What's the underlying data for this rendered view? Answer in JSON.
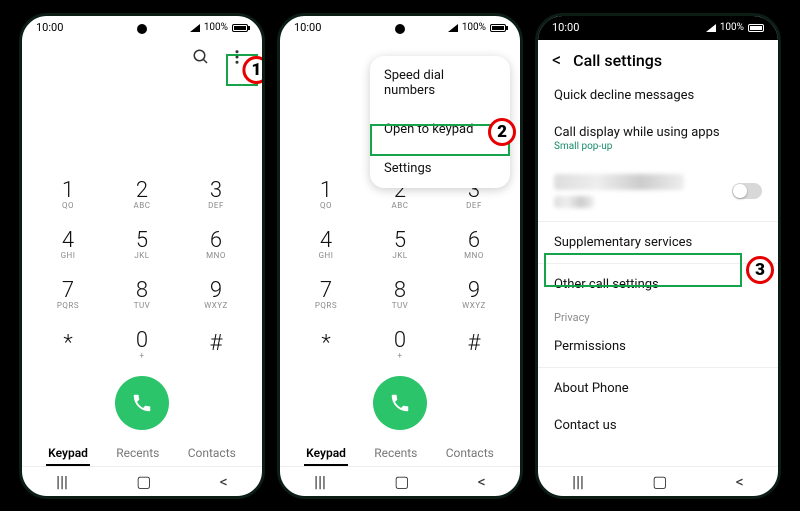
{
  "status": {
    "time": "10:00",
    "battery": "100%"
  },
  "phone1": {
    "tabs": {
      "keypad": "Keypad",
      "recents": "Recents",
      "contacts": "Contacts"
    },
    "marker": "1"
  },
  "keypad": [
    {
      "d": "1",
      "s": "QO"
    },
    {
      "d": "2",
      "s": "ABC"
    },
    {
      "d": "3",
      "s": "DEF"
    },
    {
      "d": "4",
      "s": "GHI"
    },
    {
      "d": "5",
      "s": "JKL"
    },
    {
      "d": "6",
      "s": "MNO"
    },
    {
      "d": "7",
      "s": "PQRS"
    },
    {
      "d": "8",
      "s": "TUV"
    },
    {
      "d": "9",
      "s": "WXYZ"
    },
    {
      "d": "*",
      "s": ""
    },
    {
      "d": "0",
      "s": "+"
    },
    {
      "d": "#",
      "s": ""
    }
  ],
  "phone2": {
    "menu": {
      "speed": "Speed dial numbers",
      "open": "Open to keypad",
      "settings": "Settings"
    },
    "marker": "2"
  },
  "phone3": {
    "title": "Call settings",
    "rows": {
      "quick": "Quick decline messages",
      "display": "Call display while using apps",
      "display_sub": "Small pop-up",
      "supp": "Supplementary services",
      "other": "Other call settings",
      "privacy": "Privacy",
      "perm": "Permissions",
      "about": "About Phone",
      "contact": "Contact us"
    },
    "marker": "3"
  }
}
